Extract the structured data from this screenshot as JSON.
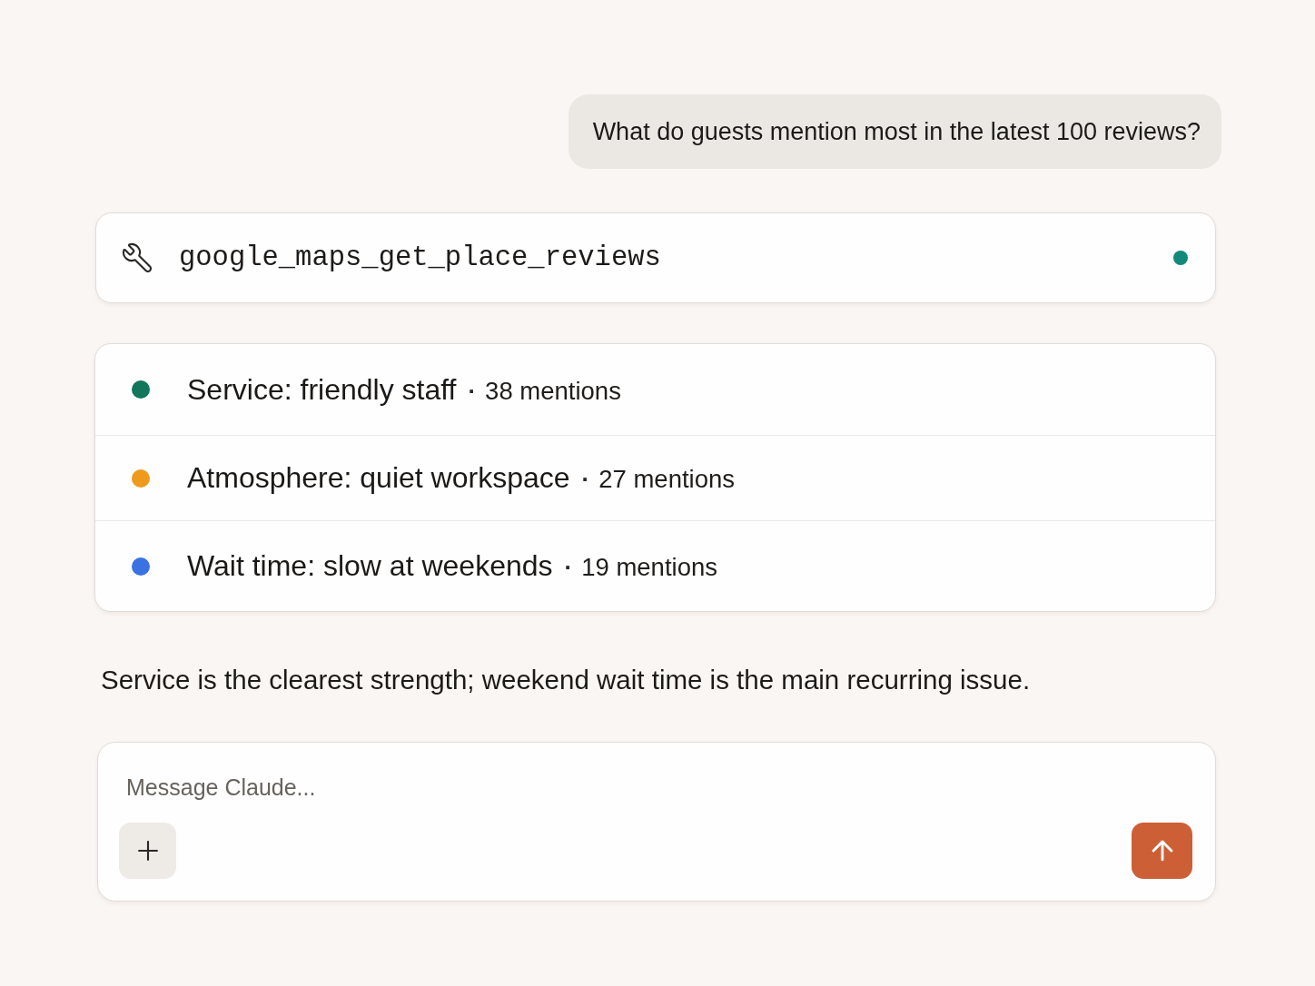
{
  "user_message": {
    "text": "What do guests mention most in the latest 100 reviews?"
  },
  "tool_calls": [
    {
      "name": "google_maps_get_place_reviews",
      "color": "#13897b"
    }
  ],
  "findings": [
    {
      "label": "Service: friendly staff",
      "separator": "·",
      "count": "38 mentions",
      "color": "#11765a"
    },
    {
      "label": "Atmosphere: quiet workspace",
      "separator": "·",
      "count": "27 mentions",
      "color": "#ee9a1c"
    },
    {
      "label": "Wait time: slow at weekends",
      "separator": "·",
      "count": "19 mentions",
      "color": "#3a72e2"
    }
  ],
  "summary": "Service is the clearest strength; weekend wait time is the main recurring issue.",
  "composer": {
    "placeholder": "Message Claude..."
  }
}
